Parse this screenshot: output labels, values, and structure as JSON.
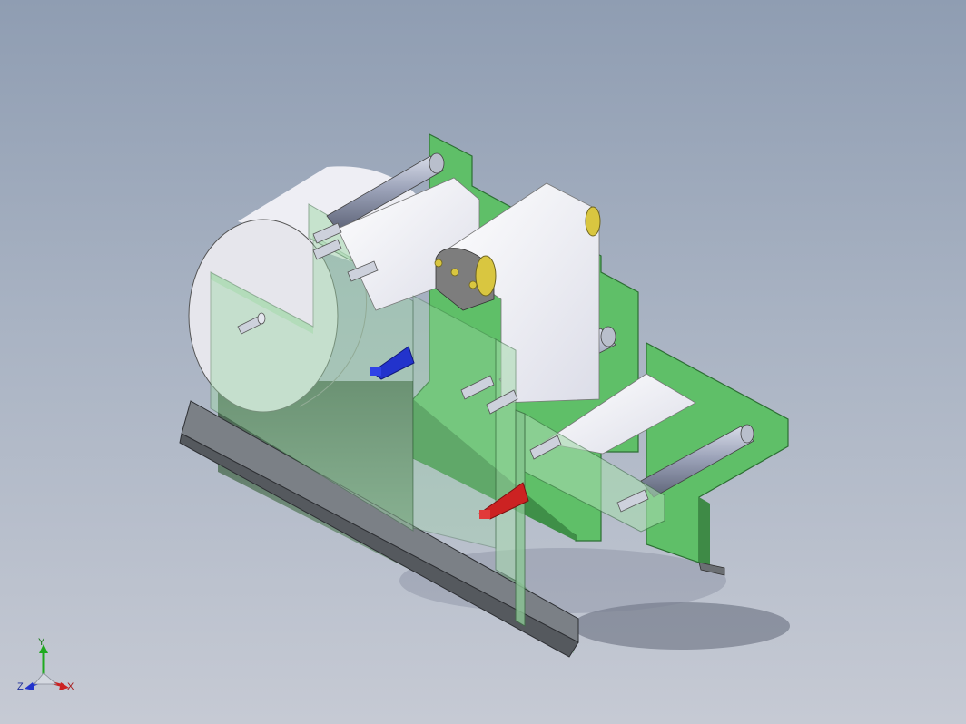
{
  "view": {
    "background_top": "#8f9db2",
    "background_bottom": "#c6cad4"
  },
  "model": {
    "parts": [
      "large-supply-roll",
      "left-side-plate",
      "right-side-plate",
      "base-angle-rail",
      "green-frame-plate",
      "green-output-bracket",
      "guide-rollers",
      "film-web",
      "blue-cone-spindle",
      "red-cone-spindle"
    ],
    "colors": {
      "frame": "#5fbf68",
      "glass": "#9fd7a8",
      "rail": "#6b6f73",
      "roller": "#9aa0b4",
      "film": "#f3f3f8",
      "blue_spindle": "#2233cc",
      "red_spindle": "#cc2222",
      "bearing": "#d9c640"
    }
  },
  "triad": {
    "y_label": "Y",
    "z_label": "Z",
    "x_label": "X",
    "y_color": "#1faa1f",
    "z_color": "#2233cc",
    "x_color": "#cc2222"
  }
}
